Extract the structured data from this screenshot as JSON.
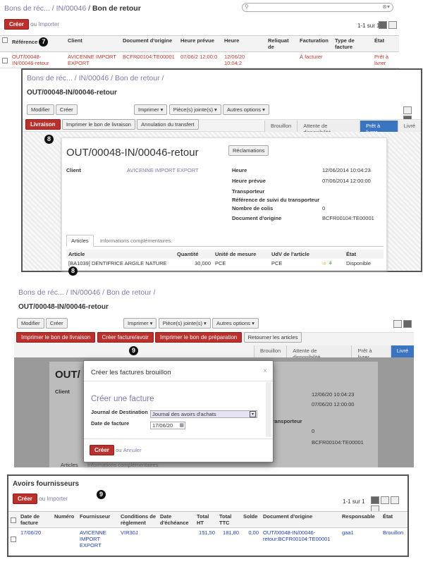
{
  "p1": {
    "breadcrumb": [
      "Bons de réc...",
      "IN/00046",
      "Bon de retour"
    ],
    "create": "Créer",
    "or": "ou",
    "import": "Importer",
    "pager": "1-1 sur 1",
    "badge": "7",
    "headers": [
      "Référence",
      "Client",
      "Document d'origine",
      "Heure prévue",
      "Heure",
      "Reliquat de",
      "Facturation",
      "Type de facture",
      "État"
    ],
    "row": [
      "OUT/00048-IN/00046-retour",
      "AVICENNE IMPORT EXPORT",
      "BCFR00104:TE00001",
      "07/06/2 12:00:0",
      "12/06/20 10:04:2",
      "",
      "À facturer",
      "",
      "Prêt à livrer"
    ]
  },
  "p2": {
    "breadcrumb": [
      "Bons de réc...",
      "IN/00046",
      "Bon de retour"
    ],
    "title": "OUT/00048-IN/00046-retour",
    "edit": "Modifier",
    "create": "Créer",
    "print": "Imprimer",
    "attachments": "Pièce(s) jointe(s)",
    "more": "Autres options",
    "actions": [
      "Livraison",
      "Imprimer le bon de livraison",
      "Annulation du transfert"
    ],
    "steps": [
      "Brouillon",
      "Attente de disponibilité",
      "Prêt à livrer",
      "Livré"
    ],
    "badge": "8",
    "doc_title": "OUT/00048-IN/00046-retour",
    "claims": "Réclamations",
    "client_label": "Client",
    "client_value": "AVICENNE IMPORT EXPORT",
    "right_fields": [
      {
        "label": "Heure",
        "value": "12/06/2014 10:04:23"
      },
      {
        "label": "Heure prévue",
        "value": "07/06/2014 12:00:00"
      },
      {
        "label": "Transporteur",
        "value": ""
      },
      {
        "label": "Référence de suivi du transporteur",
        "value": ""
      },
      {
        "label": "Nombre de colis",
        "value": "0"
      },
      {
        "label": "Document d'origine",
        "value": "BCFR00104:TE00001"
      }
    ],
    "tabs": [
      "Articles",
      "Informations complémentaires."
    ],
    "line_headers": [
      "Article",
      "Quantité",
      "Unité de mesure",
      "UdV de l'article",
      "",
      "État"
    ],
    "line": {
      "article": "[BA1039] DENTIFRICE ARGILE NATURE",
      "qty": "30,000",
      "uom": "PCE",
      "uos": "PCE",
      "state": "Disponible"
    },
    "line_badge": "8"
  },
  "p3": {
    "breadcrumb": [
      "Bons de réc...",
      "IN/00046",
      "Bon de retour"
    ],
    "title": "OUT/00048-IN/00046-retour",
    "edit": "Modifier",
    "create": "Créer",
    "print": "Imprimer",
    "attachments": "Pièce(s) jointe(s)",
    "more": "Autres options",
    "actions": [
      "Imprimer le bon de livraison",
      "Créer facture/avoir",
      "Imprimer le bon de préparation",
      "Retourner les articles"
    ],
    "steps": [
      "Brouillon",
      "Attente de disponibilité",
      "Prêt à livrer",
      "Livré"
    ],
    "badge": "9",
    "bg_title": "OUT/",
    "bg_client": "Client",
    "bg_values": [
      "12/06/20 10:04:23",
      "07/06/20 12:00:00",
      "transporteur",
      "0",
      "BCFR00104:TE00001"
    ],
    "bg_tab": "Articles",
    "bg_tab2": "Informations complémentaires",
    "modal": {
      "title": "Créer les factures brouillon",
      "close": "×",
      "heading": "Créer une facture",
      "journal_label": "Journal de Destination",
      "journal_value": "Journal des avoirs d'achats",
      "date_label": "Date de facture",
      "date_value": "17/06/20",
      "create": "Créer",
      "or": "ou",
      "cancel": "Annuler"
    }
  },
  "p4": {
    "title": "Avoirs fournisseurs",
    "create": "Créer",
    "or": "ou",
    "import": "Importer",
    "badge": "9",
    "pager": "1-1 sur 1",
    "headers": [
      "Date de facture",
      "Numéro",
      "Fournisseur",
      "Conditions de règlement",
      "Date d'échéance",
      "Total HT",
      "Total TTC",
      "Solde",
      "Document d'origine",
      "Responsable",
      "État"
    ],
    "row": [
      "17/06/20",
      "",
      "AVICENNE IMPORT EXPORT",
      "VIR30J",
      "",
      "151,50",
      "181,80",
      "0,00",
      "OUT/00048-IN/00046-retour:BCFR00104:TE00001",
      "gaa1",
      "Brouillon"
    ]
  },
  "colors": {
    "accent_red": "#b9302c",
    "link": "#7c7bad",
    "active_step": "#3b74c1"
  }
}
